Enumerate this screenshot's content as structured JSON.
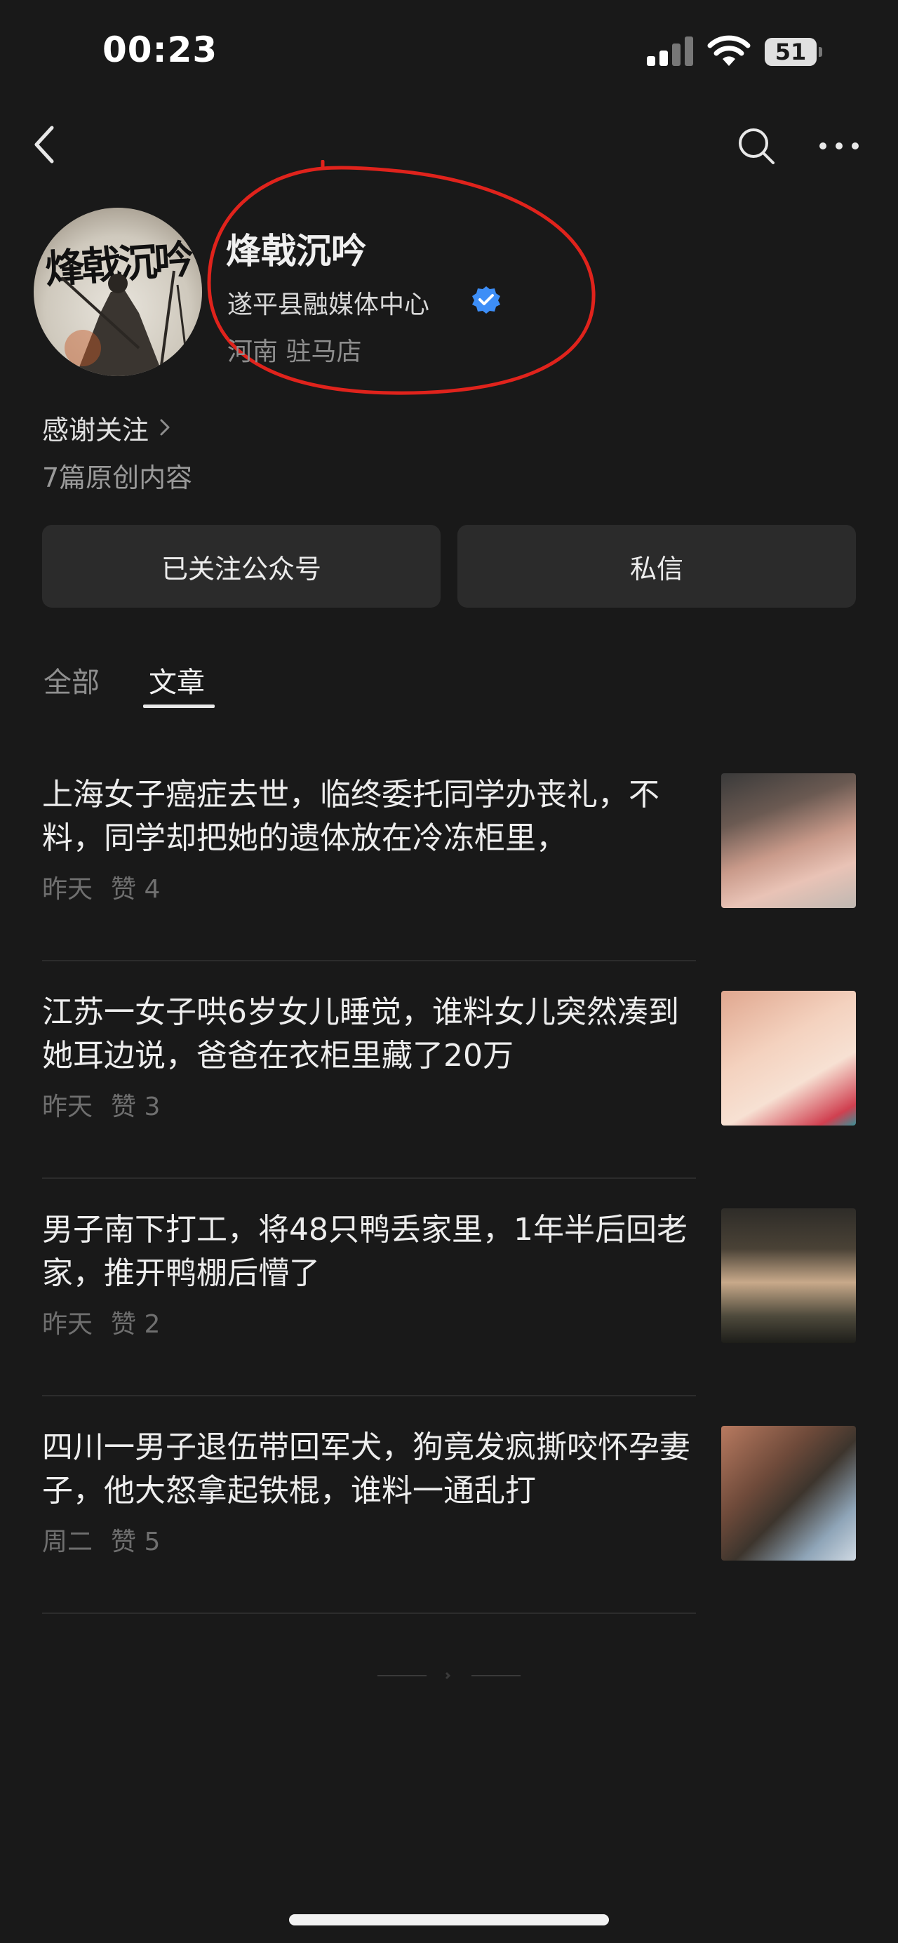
{
  "status_bar": {
    "time": "00:23",
    "battery": "51"
  },
  "profile": {
    "name": "烽戟沉吟",
    "organization": "遂平县融媒体中心",
    "region": "河南 驻马店",
    "followers_label": "感谢关注",
    "original_count": "7篇原创内容",
    "verified_color": "#3d8ef7",
    "highlight_color": "#e0231c"
  },
  "actions": {
    "follow_label": "已关注公众号",
    "message_label": "私信"
  },
  "tabs": [
    {
      "label": "全部",
      "active": false
    },
    {
      "label": "文章",
      "active": true
    }
  ],
  "articles": [
    {
      "title": "上海女子癌症去世，临终委托同学办丧礼，不料，同学却把她的遗体放在冷冻柜里，",
      "date": "昨天",
      "likes": "赞 4"
    },
    {
      "title": "江苏一女子哄6岁女儿睡觉，谁料女儿突然凑到她耳边说，爸爸在衣柜里藏了20万",
      "date": "昨天",
      "likes": "赞 3"
    },
    {
      "title": "男子南下打工，将48只鸭丢家里，1年半后回老家，推开鸭棚后懵了",
      "date": "昨天",
      "likes": "赞 2"
    },
    {
      "title": "四川一男子退伍带回军犬，狗竟发疯撕咬怀孕妻子，他大怒拿起铁棍，谁料一通乱打",
      "date": "周二",
      "likes": "赞 5"
    }
  ]
}
